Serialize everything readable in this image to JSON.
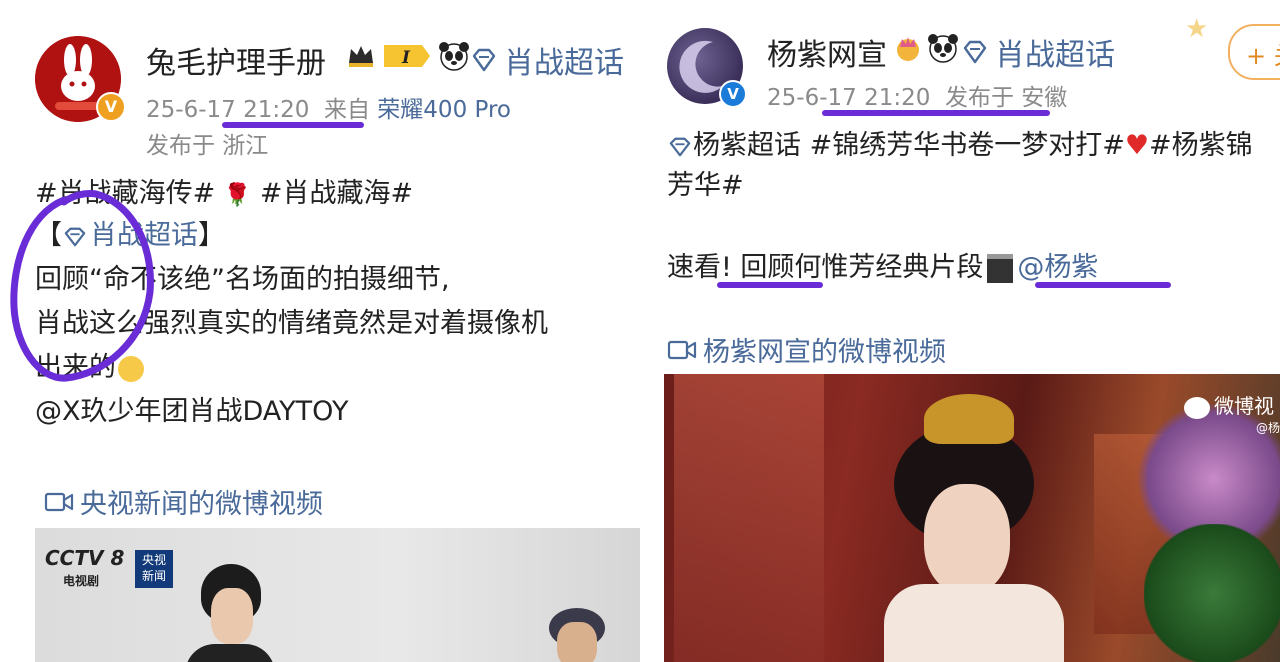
{
  "left_post": {
    "author": "兔毛护理手册",
    "super_topic": "肖战超话",
    "time": "25-6-17 21:20",
    "source_prefix": "来自",
    "device": "荣耀400 Pro",
    "location": "发布于 浙江",
    "hashtag1": "#肖战藏海传#",
    "hashtag2": "#肖战藏海#",
    "bracket_open": "【",
    "bracket_topic": "肖战超话",
    "bracket_close": "】",
    "line1": "回顾“命不该绝”名场面的拍摄细节,",
    "line2": "肖战这么强烈真实的情绪竟然是对着摄像机",
    "line3": "出来的",
    "mention": "@X玖少年团肖战DAYTOY",
    "video_link": "央视新闻的微博视频",
    "video": {
      "channel": "CCTV 8",
      "channel_sub": "电视剧",
      "news_tag": "央视\n新闻"
    }
  },
  "right_post": {
    "author": "杨紫网宣",
    "super_topic": "肖战超话",
    "time": "25-6-17 21:20",
    "location": "发布于 安徽",
    "follow_label": "+ 关",
    "tags_line1": "杨紫超话 #锦绣芳华书卷一梦对打#",
    "tags_line1_end": "#杨紫锦",
    "tags_line2": "芳华#",
    "body": "速看! 回顾何惟芳经典片段",
    "mention": "@杨紫",
    "video_link": "杨紫网宣的微博视频",
    "watermark": "微博视",
    "watermark_sub": "@杨"
  },
  "colors": {
    "link": "#4a6a9a",
    "annotation": "#6a2cd6",
    "meta": "#8a8a8a"
  },
  "icons": [
    "crown-badge-icon",
    "level-badge-icon",
    "panda-icon",
    "diamond-icon",
    "verified-icon",
    "rose-icon",
    "video-camera-icon",
    "clapper-icon",
    "heart-icon",
    "smile-icon"
  ]
}
